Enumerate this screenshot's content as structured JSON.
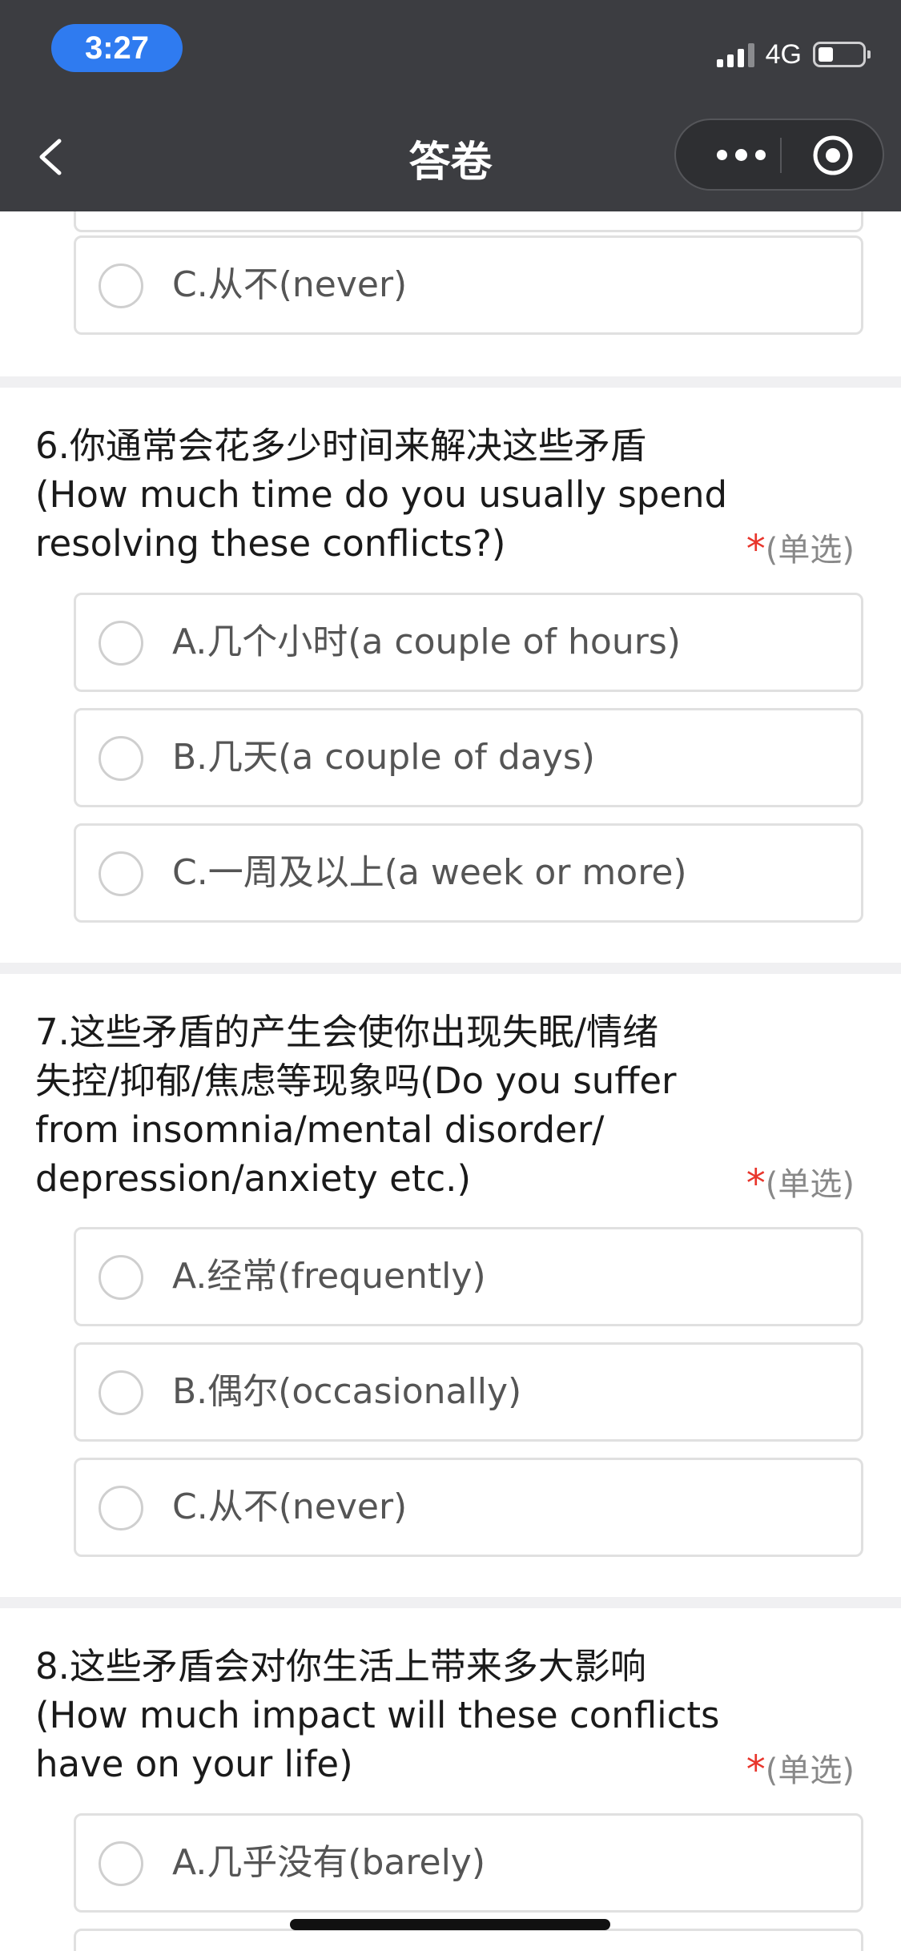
{
  "status_bar": {
    "time": "3:27",
    "network": "4G"
  },
  "nav": {
    "title": "答卷",
    "back_icon": "chevron-left-icon",
    "more_icon": "more-dots-icon",
    "close_icon": "target-icon"
  },
  "questions": [
    {
      "options": [
        "C.从不(never)"
      ]
    },
    {
      "lines": [
        "6.你通常会花多少时间来解决这些矛盾",
        "(How much time do you usually spend",
        "resolving these conflicts?)"
      ],
      "tag": "(单选)",
      "required": "*",
      "options": [
        "A.几个小时(a couple of hours)",
        "B.几天(a couple of days)",
        "C.一周及以上(a week or more)"
      ]
    },
    {
      "lines": [
        "7.这些矛盾的产生会使你出现失眠/情绪",
        "失控/抑郁/焦虑等现象吗(Do you suffer",
        "from insomnia/mental disorder/",
        "depression/anxiety etc.)"
      ],
      "tag": "(单选)",
      "required": "*",
      "options": [
        "A.经常(frequently)",
        "B.偶尔(occasionally)",
        "C.从不(never)"
      ]
    },
    {
      "lines": [
        "8.这些矛盾会对你生活上带来多大影响",
        "(How much impact will these conflicts",
        "have on your life)"
      ],
      "tag": "(单选)",
      "required": "*",
      "options": [
        "A.几乎没有(barely)"
      ]
    }
  ],
  "colors": {
    "topbar": "#3c3d41",
    "time_pill": "#2f7bf0",
    "required_star": "#e8352b",
    "separator": "#f0f0f2"
  }
}
